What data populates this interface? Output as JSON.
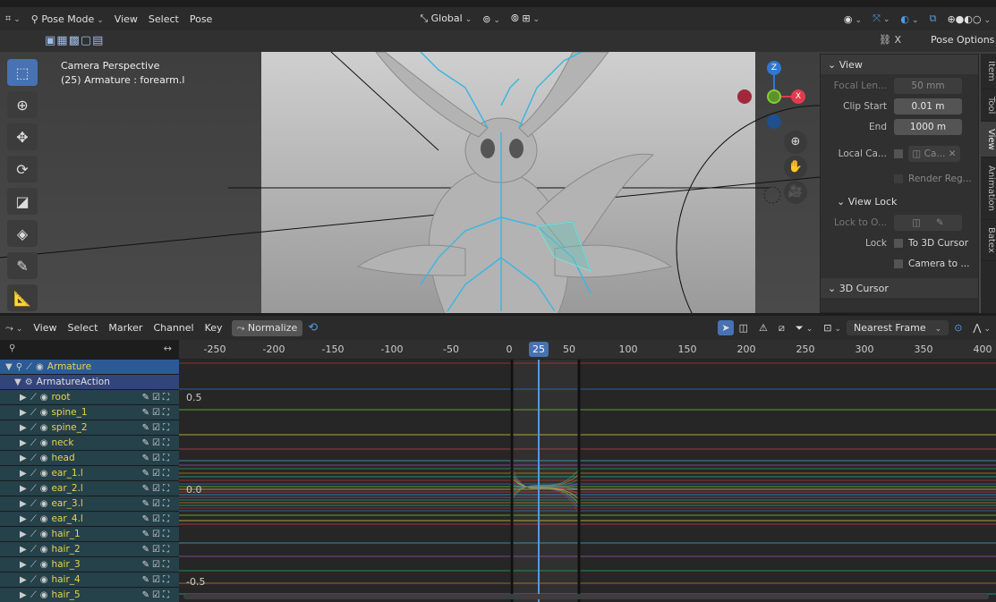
{
  "header": {
    "mode": "Pose Mode",
    "menus": [
      "View",
      "Select",
      "Pose"
    ],
    "orientation": "Global",
    "pose_options": "Pose Options"
  },
  "viewport": {
    "camera_text": "Camera Perspective",
    "object_text": "(25) Armature : forearm.l",
    "gizmo": {
      "z": "Z",
      "x": "X"
    }
  },
  "npanel": {
    "view_header": "View",
    "focal_label": "Focal Len...",
    "focal_value": "50 mm",
    "clip_start_label": "Clip Start",
    "clip_start_value": "0.01 m",
    "end_label": "End",
    "end_value": "1000 m",
    "local_camera_label": "Local Ca...",
    "local_camera_value": "Ca...",
    "render_region": "Render Reg...",
    "view_lock_header": "View Lock",
    "lock_to_label": "Lock to O...",
    "lock_label": "Lock",
    "to_3d_cursor": "To 3D Cursor",
    "camera_to": "Camera to ...",
    "cursor_header": "3D Cursor",
    "tabs": [
      "Item",
      "Tool",
      "View",
      "Animation",
      "Batex"
    ]
  },
  "graph_header": {
    "menus": [
      "View",
      "Select",
      "Marker",
      "Channel",
      "Key"
    ],
    "normalize": "Normalize",
    "snap": "Nearest Frame"
  },
  "timeline": {
    "ticks": [
      "-250",
      "-200",
      "-150",
      "-100",
      "-50",
      "0",
      "50",
      "100",
      "150",
      "200",
      "250",
      "300",
      "350",
      "400"
    ],
    "current_frame": "25"
  },
  "graph": {
    "y_labels": [
      "0.5",
      "0.0",
      "-0.5"
    ]
  },
  "channels": {
    "armature": "Armature",
    "action": "ArmatureAction",
    "groups": [
      "root",
      "spine_1",
      "spine_2",
      "neck",
      "head",
      "ear_1.l",
      "ear_2.l",
      "ear_3.l",
      "ear_4.l",
      "hair_1",
      "hair_2",
      "hair_3",
      "hair_4",
      "hair_5"
    ]
  },
  "colors": {
    "accent": "#4772b3",
    "group_text": "#e8d44d",
    "bone": "#3fb6e0",
    "x_axis": "#e23b4e",
    "y_axis": "#7fd22f",
    "z_axis": "#2f78d2"
  }
}
